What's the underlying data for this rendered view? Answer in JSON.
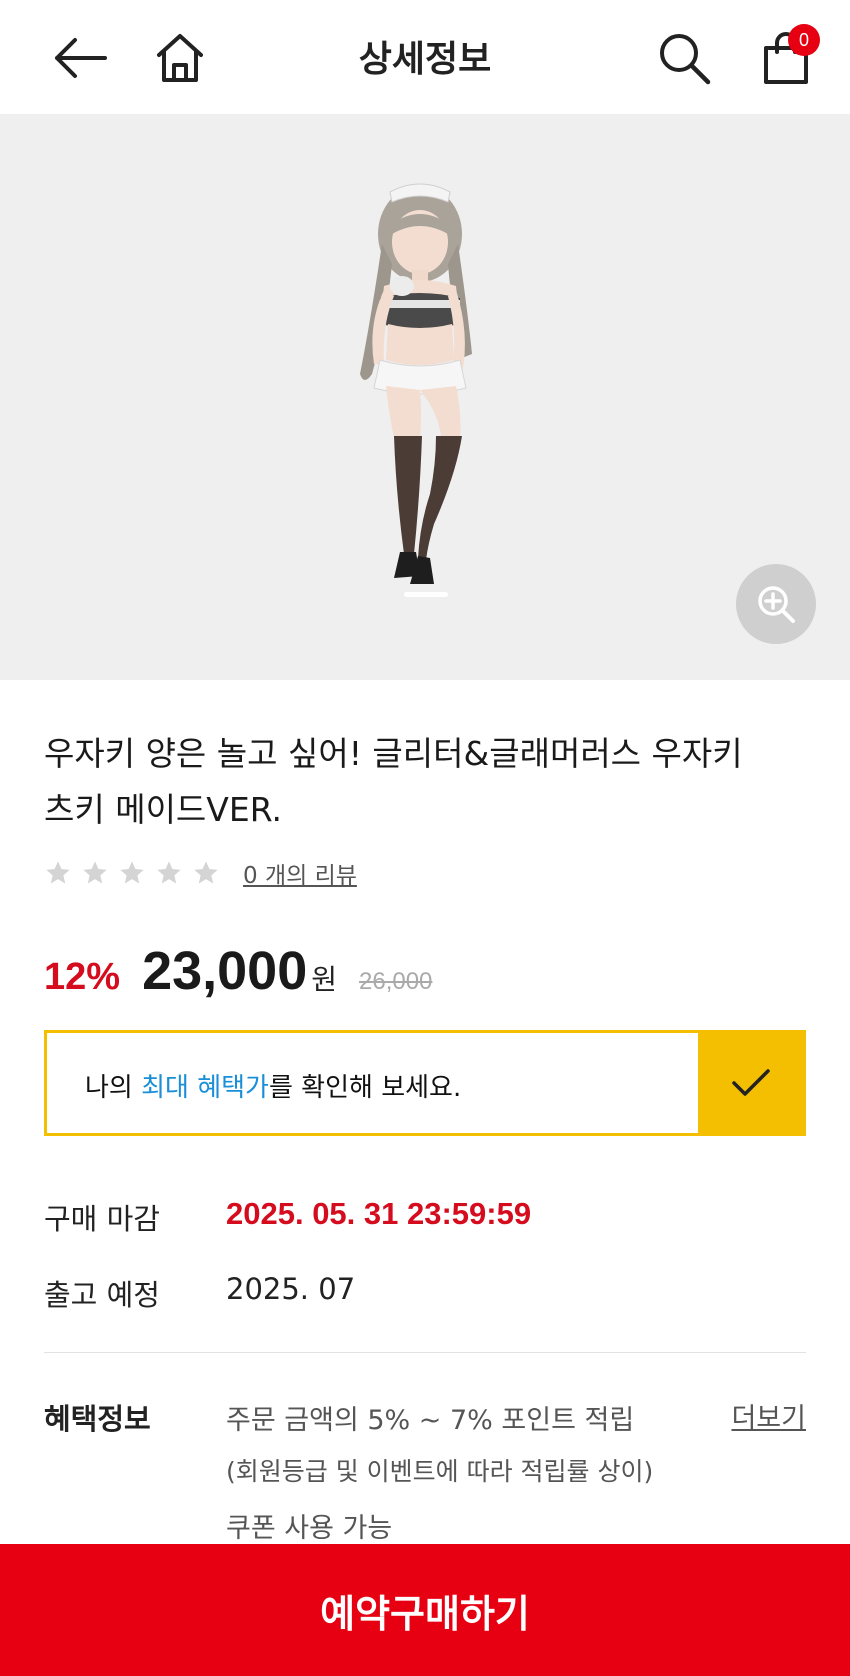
{
  "header": {
    "title": "상세정보",
    "cart_count": "0",
    "back_icon": "arrow-left-icon",
    "home_icon": "home-icon",
    "search_icon": "search-icon",
    "cart_icon": "shopping-bag-icon"
  },
  "gallery": {
    "image_alt": "",
    "slide_index": 1,
    "slide_count": 1,
    "zoom_icon": "zoom-in-icon"
  },
  "product": {
    "title_line1": "우자키 양은 놀고 싶어! 글리터&글래머러스 우자키",
    "title_line2": "츠키 메이드VER.",
    "rating": 0,
    "review_link": "0 개의 리뷰"
  },
  "price": {
    "discount": "12%",
    "current": "23,000",
    "currency": "원",
    "original": "26,000"
  },
  "benefit_banner": {
    "prefix": "나의 ",
    "highlight": "최대 혜택가",
    "suffix": "를 확인해 보세요.",
    "check_icon": "check-icon"
  },
  "schedule": {
    "deadline_label": "구매 마감",
    "deadline_value": "2025. 05. 31 23:59:59",
    "release_label": "출고 예정",
    "release_value": "2025. 07"
  },
  "benefits": {
    "label": "혜택정보",
    "line1": "주문 금액의 5% ~ 7% 포인트 적립",
    "line2": "(회원등급 및 이벤트에 따라 적립률 상이)",
    "line3": "쿠폰 사용 가능",
    "more": "더보기"
  },
  "buy_button": {
    "label": "예약구매하기"
  },
  "colors": {
    "accent_red": "#e60012",
    "price_red": "#d50b1e",
    "banner_yellow": "#f3bf00",
    "highlight_blue": "#1a8fd8"
  }
}
